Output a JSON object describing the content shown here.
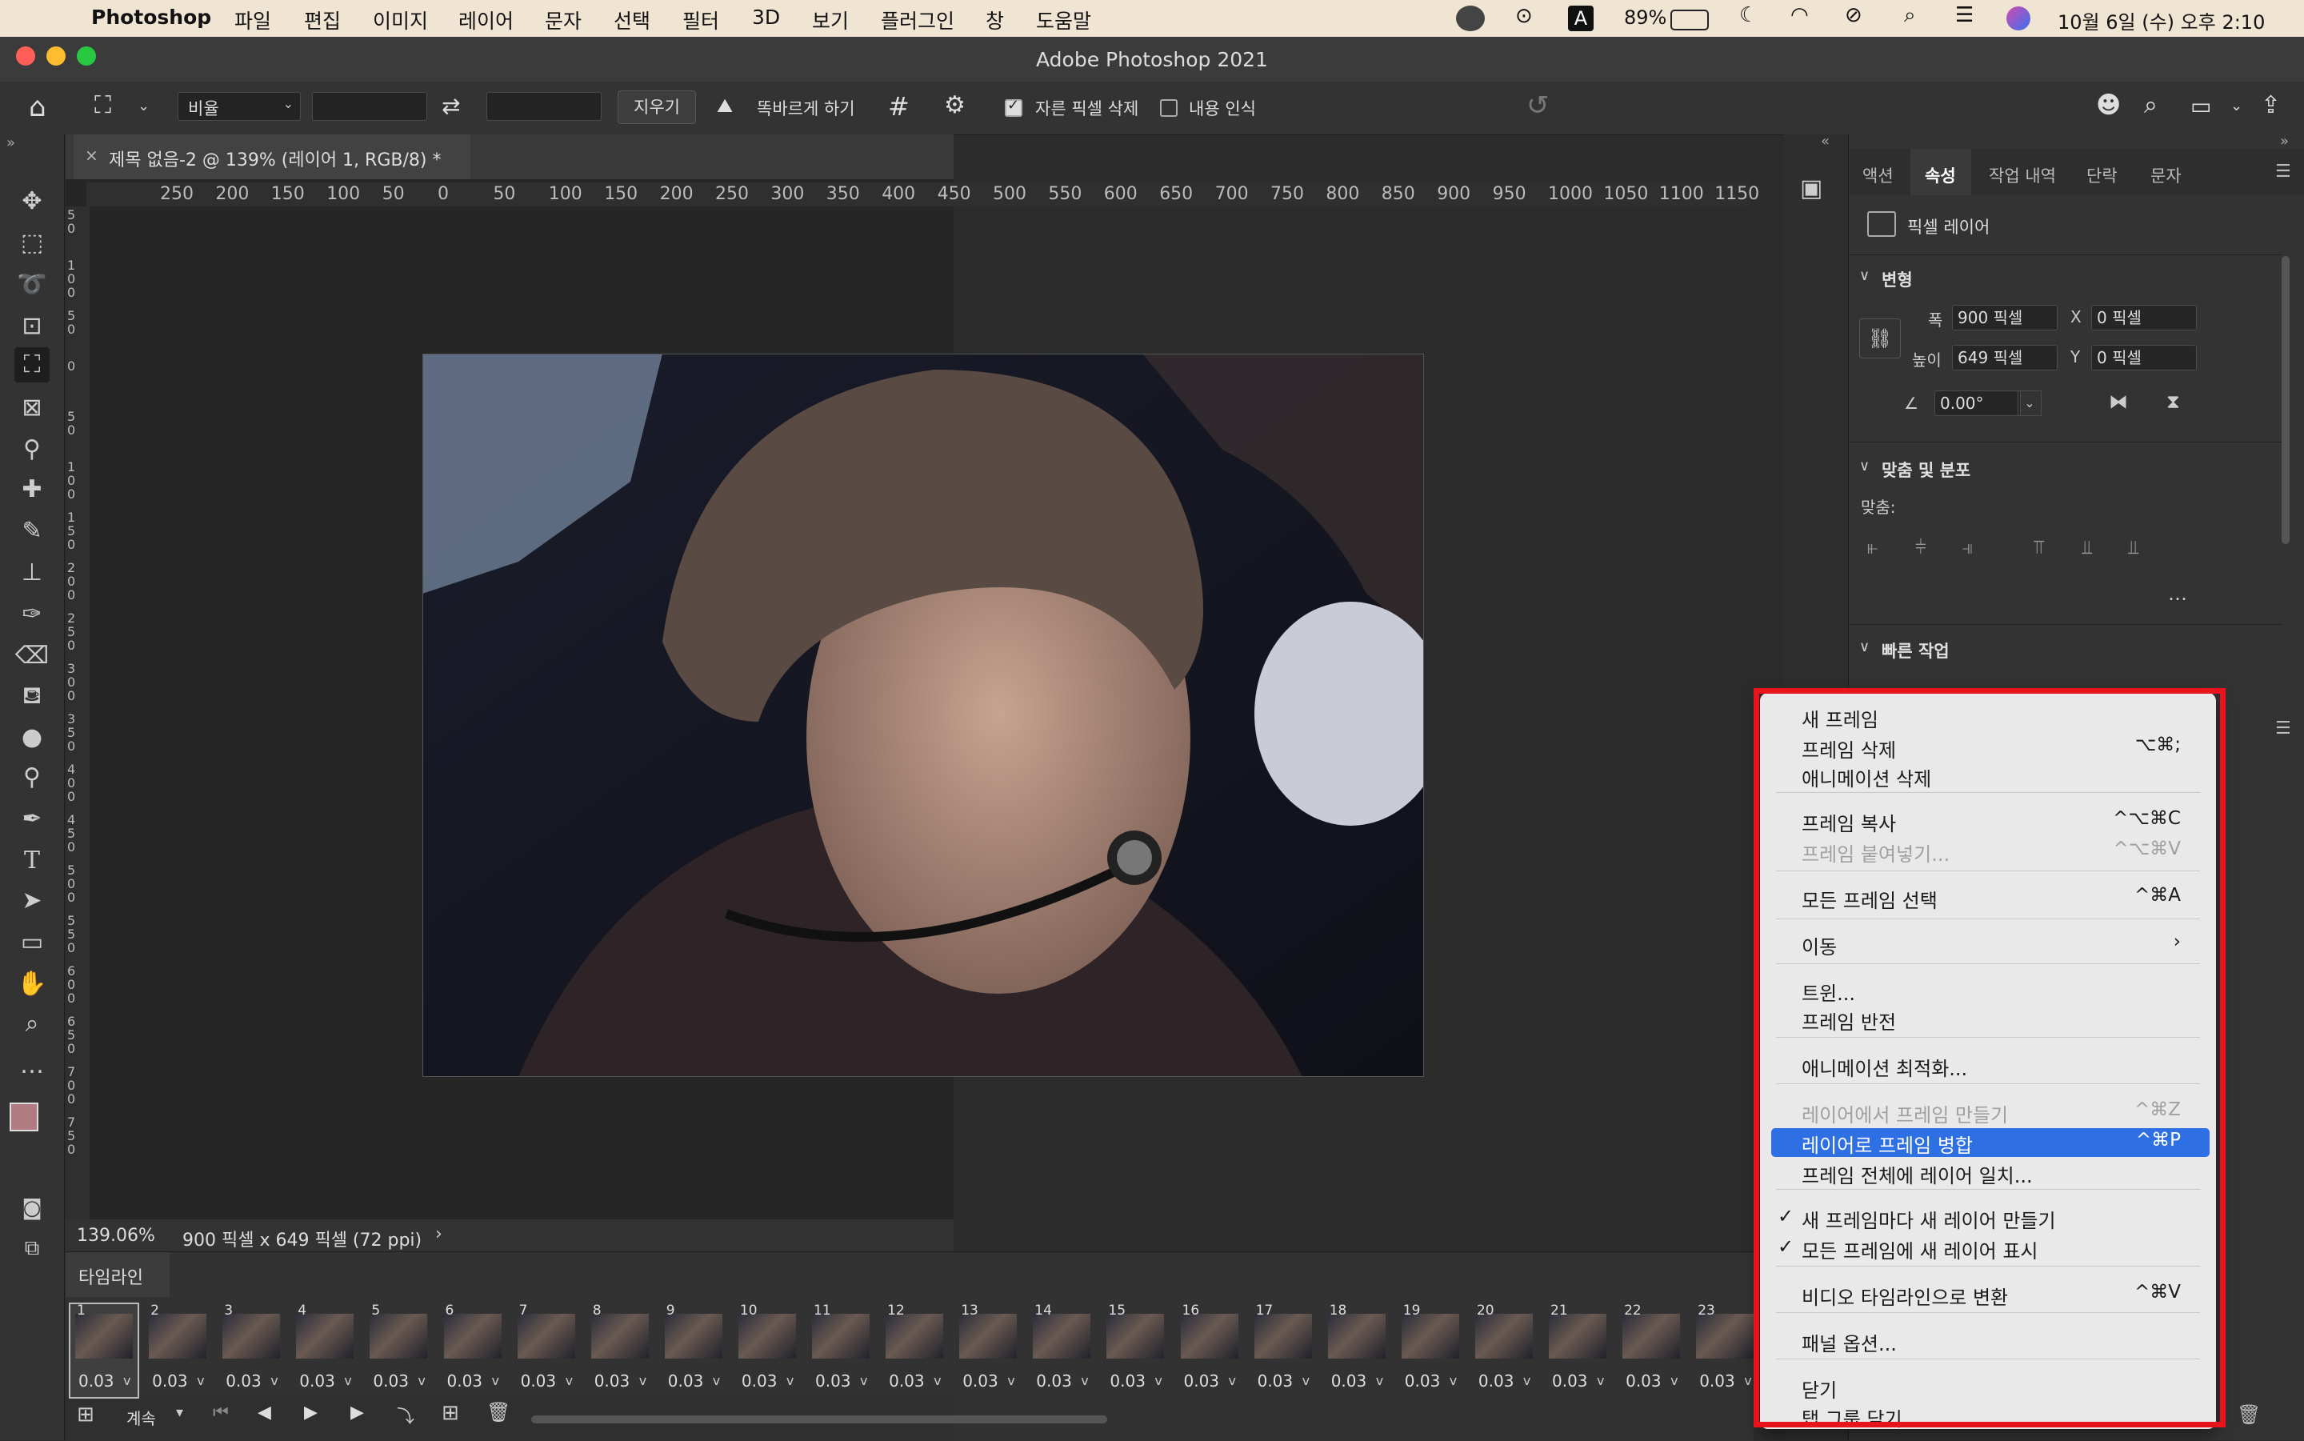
{
  "menubar": {
    "app_name": "Photoshop",
    "items": [
      "파일",
      "편집",
      "이미지",
      "레이어",
      "문자",
      "선택",
      "필터",
      "3D",
      "보기",
      "플러그인",
      "창",
      "도움말"
    ],
    "battery": "89%",
    "input_mode": "A",
    "clock": "10월 6일 (수) 오후 2:10"
  },
  "window": {
    "title": "Adobe Photoshop 2021"
  },
  "options": {
    "ratio_value": "비율",
    "clear_label": "지우기",
    "straighten_label": "똑바르게 하기",
    "delete_cropped_label": "자른 픽셀 삭제",
    "delete_cropped_checked": true,
    "content_aware_label": "내용 인식",
    "content_aware_checked": false
  },
  "document": {
    "tab_label": "제목 없음-2 @ 139% (레이어 1, RGB/8) *",
    "ruler_h": [
      "250",
      "200",
      "150",
      "100",
      "50",
      "0",
      "50",
      "100",
      "150",
      "200",
      "250",
      "300",
      "350",
      "400",
      "450",
      "500",
      "550",
      "600",
      "650",
      "700",
      "750",
      "800",
      "850",
      "900",
      "950",
      "1000",
      "1050",
      "1100",
      "1150"
    ],
    "ruler_v": [
      "5\n0",
      "1\n0\n0",
      "5\n0",
      "0",
      "5\n0",
      "1\n0\n0",
      "1\n5\n0",
      "2\n0\n0",
      "2\n5\n0",
      "3\n0\n0",
      "3\n5\n0",
      "4\n0\n0",
      "4\n5\n0",
      "5\n0\n0",
      "5\n5\n0",
      "6\n0\n0",
      "6\n5\n0",
      "7\n0\n0",
      "7\n5\n0"
    ],
    "zoom": "139.06%",
    "doc_info": "900 픽셀 x 649 픽셀 (72 ppi)"
  },
  "timeline": {
    "title": "타임라인",
    "loop_label": "계속",
    "frames": [
      {
        "n": "1",
        "d": "0.03"
      },
      {
        "n": "2",
        "d": "0.03"
      },
      {
        "n": "3",
        "d": "0.03"
      },
      {
        "n": "4",
        "d": "0.03"
      },
      {
        "n": "5",
        "d": "0.03"
      },
      {
        "n": "6",
        "d": "0.03"
      },
      {
        "n": "7",
        "d": "0.03"
      },
      {
        "n": "8",
        "d": "0.03"
      },
      {
        "n": "9",
        "d": "0.03"
      },
      {
        "n": "10",
        "d": "0.03"
      },
      {
        "n": "11",
        "d": "0.03"
      },
      {
        "n": "12",
        "d": "0.03"
      },
      {
        "n": "13",
        "d": "0.03"
      },
      {
        "n": "14",
        "d": "0.03"
      },
      {
        "n": "15",
        "d": "0.03"
      },
      {
        "n": "16",
        "d": "0.03"
      },
      {
        "n": "17",
        "d": "0.03"
      },
      {
        "n": "18",
        "d": "0.03"
      },
      {
        "n": "19",
        "d": "0.03"
      },
      {
        "n": "20",
        "d": "0.03"
      },
      {
        "n": "21",
        "d": "0.03"
      },
      {
        "n": "22",
        "d": "0.03"
      },
      {
        "n": "23",
        "d": "0.03"
      }
    ]
  },
  "properties": {
    "tabs": [
      "액션",
      "속성",
      "작업 내역",
      "단락",
      "문자"
    ],
    "active_tab": "속성",
    "layer_type": "픽셀 레이어",
    "transform_title": "변형",
    "width_label": "폭",
    "width_value": "900 픽셀",
    "height_label": "높이",
    "height_value": "649 픽셀",
    "x_label": "X",
    "x_value": "0 픽셀",
    "y_label": "Y",
    "y_value": "0 픽셀",
    "angle_value": "0.00°",
    "align_title": "맞춤 및 분포",
    "align_label": "맞춤:",
    "quick_title": "빠른 작업"
  },
  "context_menu": {
    "items": [
      {
        "label": "새 프레임",
        "key": "",
        "disabled": false,
        "checked": false,
        "selected": false
      },
      {
        "label": "프레임 삭제",
        "key": "⌥⌘;",
        "disabled": false,
        "checked": false,
        "selected": false
      },
      {
        "label": "애니메이션 삭제",
        "key": "",
        "disabled": false,
        "checked": false,
        "selected": false
      },
      {
        "label": "프레임 복사",
        "key": "^⌥⌘C",
        "disabled": false,
        "checked": false,
        "selected": false
      },
      {
        "label": "프레임 붙여넣기...",
        "key": "^⌥⌘V",
        "disabled": true,
        "checked": false,
        "selected": false
      },
      {
        "label": "모든 프레임 선택",
        "key": "^⌘A",
        "disabled": false,
        "checked": false,
        "selected": false
      },
      {
        "label": "이동",
        "key": "›",
        "disabled": false,
        "checked": false,
        "selected": false
      },
      {
        "label": "트윈...",
        "key": "",
        "disabled": false,
        "checked": false,
        "selected": false
      },
      {
        "label": "프레임 반전",
        "key": "",
        "disabled": false,
        "checked": false,
        "selected": false
      },
      {
        "label": "애니메이션 최적화...",
        "key": "",
        "disabled": false,
        "checked": false,
        "selected": false
      },
      {
        "label": "레이어에서 프레임 만들기",
        "key": "^⌘Z",
        "disabled": true,
        "checked": false,
        "selected": false
      },
      {
        "label": "레이어로 프레임 병합",
        "key": "^⌘P",
        "disabled": false,
        "checked": false,
        "selected": true
      },
      {
        "label": "프레임 전체에 레이어 일치...",
        "key": "",
        "disabled": false,
        "checked": false,
        "selected": false
      },
      {
        "label": "새 프레임마다 새 레이어 만들기",
        "key": "",
        "disabled": false,
        "checked": true,
        "selected": false
      },
      {
        "label": "모든 프레임에 새 레이어 표시",
        "key": "",
        "disabled": false,
        "checked": true,
        "selected": false
      },
      {
        "label": "비디오 타임라인으로 변환",
        "key": "^⌘V",
        "disabled": false,
        "checked": false,
        "selected": false
      },
      {
        "label": "패널 옵션...",
        "key": "",
        "disabled": false,
        "checked": false,
        "selected": false
      },
      {
        "label": "닫기",
        "key": "",
        "disabled": false,
        "checked": false,
        "selected": false
      },
      {
        "label": "탭 그룹 닫기",
        "key": "",
        "disabled": false,
        "checked": false,
        "selected": false
      }
    ]
  },
  "colors": {
    "menu_highlight": "#2f6fe4",
    "annotation_red": "#e8131b",
    "foreground_swatch": "#b07c82"
  }
}
